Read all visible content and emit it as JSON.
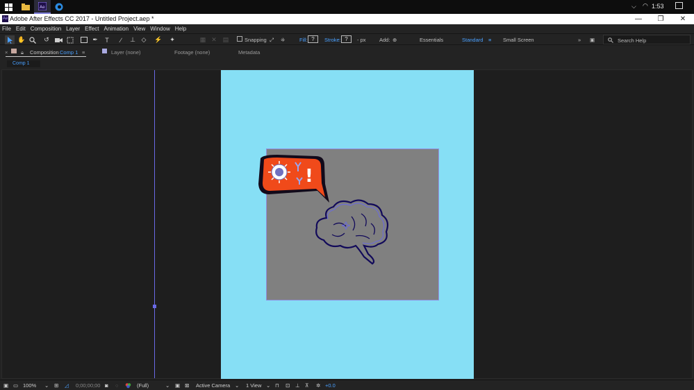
{
  "taskbar": {
    "clock": "1:53"
  },
  "window": {
    "title": "Adobe After Effects CC 2017 - Untitled Project.aep *"
  },
  "menu": [
    "File",
    "Edit",
    "Composition",
    "Layer",
    "Effect",
    "Animation",
    "View",
    "Window",
    "Help"
  ],
  "toolbar": {
    "snapping": "Snapping",
    "fill_label": "Fill:",
    "fill_value": "?",
    "stroke_label": "Stroke:",
    "stroke_value": "?",
    "stroke_unit": "- px",
    "add_label": "Add:",
    "workspace_essentials": "Essentials",
    "workspace_standard": "Standard",
    "workspace_small": "Small Screen",
    "search_placeholder": "Search Help"
  },
  "panels": {
    "composition_label": "Composition",
    "composition_name": "Comp 1",
    "layer_tab": "Layer  (none)",
    "footage_tab": "Footage  (none)",
    "metadata_tab": "Metadata",
    "comp_chip": "Comp 1"
  },
  "bottom": {
    "zoom": "100%",
    "timecode": "0;00;00;00",
    "resolution": "(Full)",
    "camera": "Active Camera",
    "views": "1 View",
    "exposure": "+0.0"
  },
  "colors": {
    "canvas": "#86dff5",
    "layer": "#808080",
    "accent": "#4aa0ff",
    "bubble": "#f04a1a"
  }
}
